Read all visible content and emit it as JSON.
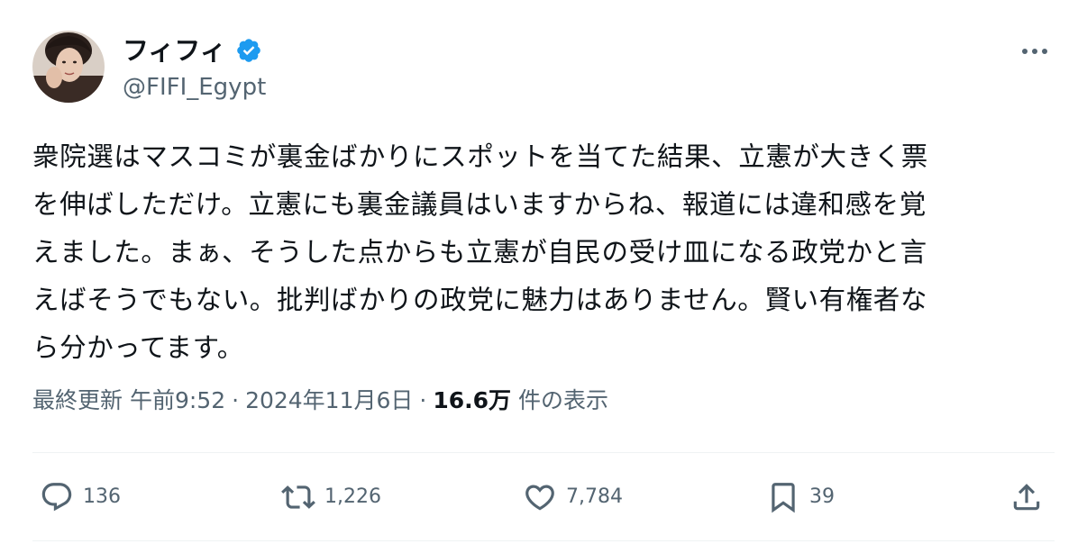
{
  "author": {
    "display_name": "フィフィ",
    "handle": "@FIFI_Egypt",
    "verified": true
  },
  "tweet": {
    "lines": [
      "衆院選はマスコミが裏金ばかりにスポットを当てた結果、立憲が大きく票",
      "を伸ばしただけ。立憲にも裏金議員はいますからね、報道には違和感を覚",
      "えました。まぁ、そうした点からも立憲が自民の受け皿になる政党かと言",
      "えばそうでもない。批判ばかりの政党に魅力はありません。賢い有権者な",
      "ら分かってます。"
    ]
  },
  "meta": {
    "edited_label": "最終更新",
    "time": "午前9:52",
    "separator": "·",
    "date": "2024年11月6日",
    "views_count": "16.6万",
    "views_label": "件の表示"
  },
  "actions": {
    "reply_count": "136",
    "repost_count": "1,226",
    "like_count": "7,784",
    "bookmark_count": "39"
  },
  "colors": {
    "text_primary": "#0f1419",
    "text_secondary": "#536471",
    "verified_blue": "#1d9bf0",
    "divider": "#eff3f4"
  },
  "icons": [
    "avatar",
    "verified-badge-icon",
    "more-icon",
    "reply-icon",
    "repost-icon",
    "like-icon",
    "bookmark-icon",
    "share-icon"
  ]
}
